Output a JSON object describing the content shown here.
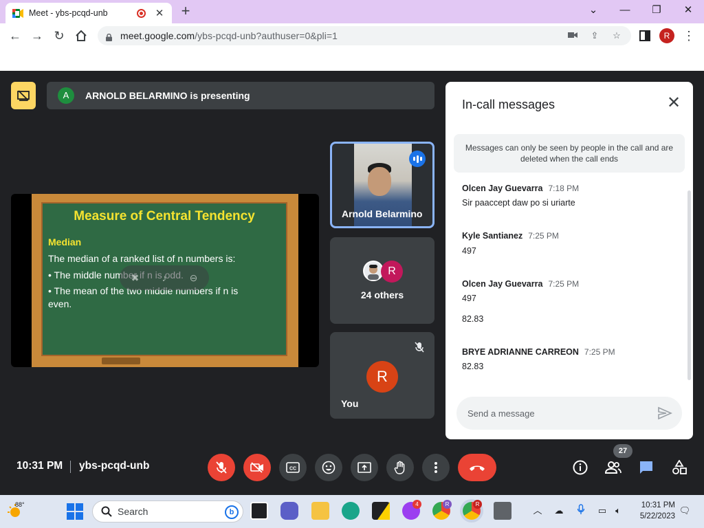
{
  "browser": {
    "tab_title": "Meet - ybs-pcqd-unb",
    "url_host": "meet.google.com",
    "url_path": "/ybs-pcqd-unb?authuser=0&pli=1",
    "profile_initial": "R"
  },
  "meet": {
    "presenting_initial": "A",
    "presenting_text": "ARNOLD BELARMINO is presenting",
    "slide": {
      "title": "Measure of Central Tendency",
      "subtitle": "Median",
      "line1": "The median of a ranked list of n numbers is:",
      "bullet1": "The middle number if n is odd.",
      "bullet2": "The mean of the two middle numbers if n  is even."
    },
    "tiles": {
      "presenter_name": "Arnold Belarmino",
      "others_initial": "R",
      "others_label": "24 others",
      "you_initial": "R",
      "you_label": "You"
    },
    "footer": {
      "time": "10:31 PM",
      "meeting_code": "ybs-pcqd-unb",
      "people_count": "27"
    },
    "chat": {
      "title": "In-call messages",
      "notice": "Messages can only be seen by people in the call and are deleted when the call ends",
      "messages": [
        {
          "sender": "Olcen Jay Guevarra",
          "time": "7:18 PM",
          "lines": [
            "Sir paaccept daw po si uriarte"
          ]
        },
        {
          "sender": "Kyle Santianez",
          "time": "7:25 PM",
          "lines": [
            "497"
          ]
        },
        {
          "sender": "Olcen Jay Guevarra",
          "time": "7:25 PM",
          "lines": [
            "497",
            "82.83"
          ]
        },
        {
          "sender": "BRYE ADRIANNE CARREON",
          "time": "7:25 PM",
          "lines": [
            "82.83"
          ]
        }
      ],
      "input_placeholder": "Send a message"
    }
  },
  "taskbar": {
    "weather_temp": "88°",
    "search_label": "Search",
    "messenger_badge": "4",
    "chrome1_badge": "R",
    "chrome2_badge": "R",
    "clock_time": "10:31 PM",
    "clock_date": "5/22/2023"
  },
  "colors": {
    "meet_bg": "#202124",
    "accent_blue": "#8ab4f8",
    "hangup_red": "#ea4335",
    "tab_strip": "#e2c8f4"
  }
}
